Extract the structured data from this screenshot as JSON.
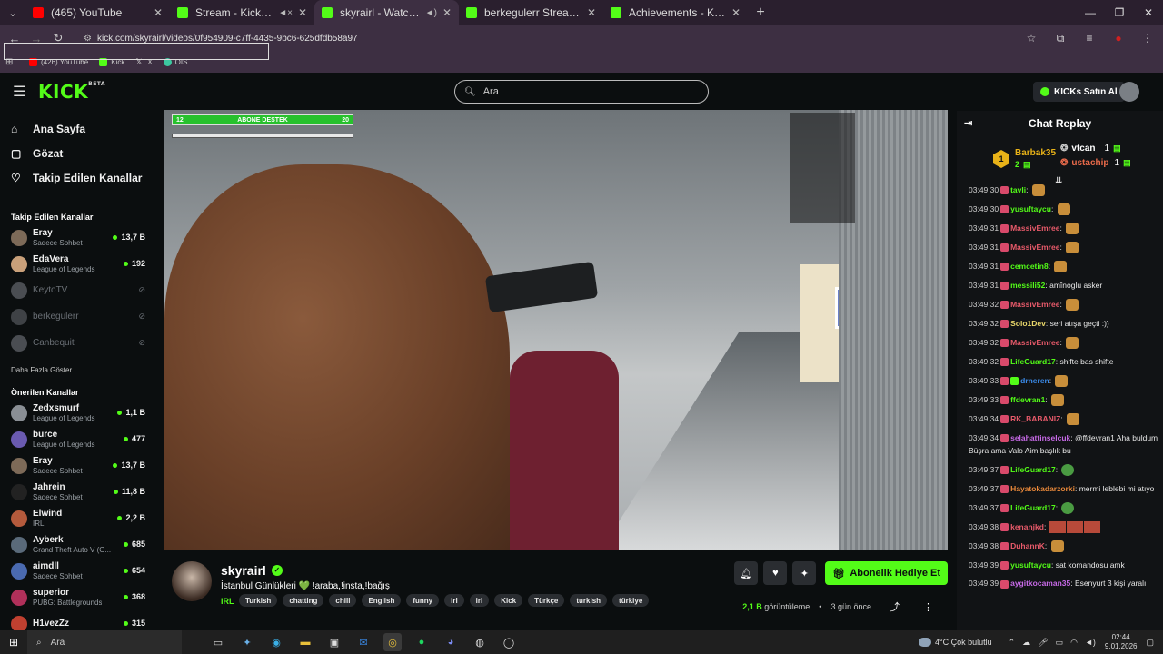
{
  "browser": {
    "tabs": [
      {
        "title": "(465) YouTube",
        "favicon": "youtube-icon",
        "audio": false,
        "active": false
      },
      {
        "title": "Stream - Kick Dashboard",
        "favicon": "kick-icon",
        "audio": true,
        "active": false
      },
      {
        "title": "skyrairl - Watch the VOD on Kick",
        "favicon": "kick-icon",
        "audio": true,
        "active": true
      },
      {
        "title": "berkegulerr Stream - Watch Live",
        "favicon": "kick-icon",
        "audio": false,
        "active": false
      },
      {
        "title": "Achievements - Kick Dashboard",
        "favicon": "kick-icon",
        "audio": false,
        "active": false
      }
    ],
    "url": "kick.com/skyrairl/videos/0f954909-c7ff-4435-9bc6-625dfdb58a97",
    "bookmarks": [
      {
        "label": "(426) YouTube",
        "color": "#ff0000"
      },
      {
        "label": "Kick",
        "color": "#53fc18"
      },
      {
        "label": "X",
        "color": "#cccccc"
      },
      {
        "label": "OIS",
        "color": "#3cc8a0"
      }
    ]
  },
  "kick": {
    "logo": "KICK",
    "logo_sup": "BETA",
    "search_placeholder": "Ara",
    "buy_kicks": "KICKs Satın Al",
    "accent": "#53fc18"
  },
  "sidebar": {
    "nav": [
      {
        "label": "Ana Sayfa",
        "icon": "home-icon",
        "glyph": "⌂"
      },
      {
        "label": "Gözat",
        "icon": "browse-icon",
        "glyph": "▢"
      },
      {
        "label": "Takip Edilen Kanallar",
        "icon": "heart-icon",
        "glyph": "♡"
      }
    ],
    "followed_title": "Takip Edilen Kanallar",
    "followed": [
      {
        "name": "Eray",
        "category": "Sadece Sohbet",
        "viewers": "13,7 B",
        "live": true,
        "color": "#7d6a58"
      },
      {
        "name": "EdaVera",
        "category": "League of Legends",
        "viewers": "192",
        "live": true,
        "color": "#c9a07a"
      },
      {
        "name": "KeytoTV",
        "category": "",
        "viewers": "⊘",
        "live": false,
        "color": "#4a4d52"
      },
      {
        "name": "berkegulerr",
        "category": "",
        "viewers": "⊘",
        "live": false,
        "color": "#3f4246"
      },
      {
        "name": "Canbequit",
        "category": "",
        "viewers": "⊘",
        "live": false,
        "color": "#4a4d52"
      }
    ],
    "show_more": "Daha Fazla Göster",
    "recommended_title": "Önerilen Kanallar",
    "recommended": [
      {
        "name": "Zedxsmurf",
        "category": "League of Legends",
        "viewers": "1,1 B",
        "color": "#8a8f95"
      },
      {
        "name": "burce",
        "category": "League of Legends",
        "viewers": "477",
        "color": "#6a5ab0"
      },
      {
        "name": "Eray",
        "category": "Sadece Sohbet",
        "viewers": "13,7 B",
        "color": "#7d6a58"
      },
      {
        "name": "Jahrein",
        "category": "Sadece Sohbet",
        "viewers": "11,8 B",
        "color": "#222222"
      },
      {
        "name": "Elwind",
        "category": "IRL",
        "viewers": "2,2 B",
        "color": "#b45a3c"
      },
      {
        "name": "Ayberk",
        "category": "Grand Theft Auto V (G...",
        "viewers": "685",
        "color": "#5a6a7a"
      },
      {
        "name": "aimdll",
        "category": "Sadece Sohbet",
        "viewers": "654",
        "color": "#4a6ab0"
      },
      {
        "name": "superior",
        "category": "PUBG: Battlegrounds",
        "viewers": "368",
        "color": "#b0305a"
      },
      {
        "name": "H1vezZz",
        "category": "",
        "viewers": "315",
        "color": "#c04030"
      }
    ]
  },
  "video_overlay": {
    "bar_left": "12",
    "bar_label": "ABONE DESTEK",
    "bar_right": "20"
  },
  "stream": {
    "channel": "skyrairl",
    "title": "İstanbul Günlükleri 💚 !araba,!insta,!bağış",
    "category": "IRL",
    "tags": [
      "Turkish",
      "chatting",
      "chill",
      "English",
      "funny",
      "irl",
      "irl",
      "Kick",
      "Türkçe",
      "turkish",
      "türkiye"
    ],
    "gift_button": "Abonelik Hediye Et",
    "views_count": "2,1 B",
    "views_label": "görüntüleme",
    "age": "3 gün önce"
  },
  "chat": {
    "title": "Chat Replay",
    "gifters": [
      {
        "name": "Barbak35",
        "count": "2",
        "color": "#e8b218"
      },
      {
        "name": "vtcan",
        "count": "1",
        "color": "#ffffff"
      },
      {
        "name": "ustachip",
        "count": "1",
        "color": "#e86a4a"
      }
    ],
    "messages": [
      {
        "time": "03:49:30",
        "user": "tavli",
        "color": "#53fc18",
        "badge": "",
        "text": "",
        "emote": "emote"
      },
      {
        "time": "03:49:30",
        "user": "yusuftaycu",
        "color": "#53fc18",
        "badge": "",
        "text": "",
        "emote": "emote"
      },
      {
        "time": "03:49:31",
        "user": "MassivEmree",
        "color": "#e85a6a",
        "badge": "",
        "text": "",
        "emote": "emote"
      },
      {
        "time": "03:49:31",
        "user": "MassivEmree",
        "color": "#e85a6a",
        "badge": "",
        "text": "",
        "emote": "emote"
      },
      {
        "time": "03:49:31",
        "user": "cemcetin8",
        "color": "#53fc18",
        "badge": "",
        "text": "",
        "emote": "emote"
      },
      {
        "time": "03:49:31",
        "user": "messili52",
        "color": "#53fc18",
        "badge": "",
        "text": "amînoglu asker",
        "emote": ""
      },
      {
        "time": "03:49:32",
        "user": "MassivEmree",
        "color": "#e85a6a",
        "badge": "",
        "text": "",
        "emote": "emote"
      },
      {
        "time": "03:49:32",
        "user": "Solo1Dev",
        "color": "#e8d66a",
        "badge": "",
        "text": "seri atışa geçti :))",
        "emote": ""
      },
      {
        "time": "03:49:32",
        "user": "MassivEmree",
        "color": "#e85a6a",
        "badge": "",
        "text": "",
        "emote": "emote"
      },
      {
        "time": "03:49:32",
        "user": "LifeGuard17",
        "color": "#53fc18",
        "badge": "",
        "text": "shifte bas shifte",
        "emote": ""
      },
      {
        "time": "03:49:33",
        "user": "drneren",
        "color": "#3a8ae8",
        "badge": "g",
        "text": "",
        "emote": "emote"
      },
      {
        "time": "03:49:33",
        "user": "ffdevran1",
        "color": "#53fc18",
        "badge": "",
        "text": "",
        "emote": "emote"
      },
      {
        "time": "03:49:34",
        "user": "RK_BABANIZ",
        "color": "#e85a6a",
        "badge": "",
        "text": "",
        "emote": "emote"
      },
      {
        "time": "03:49:34",
        "user": "selahattinselcuk",
        "color": "#c86ae8",
        "badge": "",
        "text": "@ffdevran1 Aha buldum Büşra ama Valo Aim başlık bu",
        "emote": ""
      },
      {
        "time": "03:49:37",
        "user": "LifeGuard17",
        "color": "#53fc18",
        "badge": "",
        "text": "",
        "emote": "pepe"
      },
      {
        "time": "03:49:37",
        "user": "Hayatokadarzorki",
        "color": "#e8883a",
        "badge": "",
        "text": "mermi leblebi mi atıyo",
        "emote": ""
      },
      {
        "time": "03:49:37",
        "user": "LifeGuard17",
        "color": "#53fc18",
        "badge": "",
        "text": "",
        "emote": "pepe"
      },
      {
        "time": "03:49:38",
        "user": "kenanjkd",
        "color": "#e85a6a",
        "badge": "",
        "text": "",
        "emote": "strip"
      },
      {
        "time": "03:49:38",
        "user": "DuhannK",
        "color": "#e85a6a",
        "badge": "",
        "text": "",
        "emote": "emote"
      },
      {
        "time": "03:49:39",
        "user": "yusuftaycu",
        "color": "#53fc18",
        "badge": "",
        "text": "sat komandosu amk",
        "emote": ""
      },
      {
        "time": "03:49:39",
        "user": "aygitkocaman35",
        "color": "#c86ae8",
        "badge": "",
        "text": "Esenyurt 3 kişi yaralı",
        "emote": ""
      }
    ]
  },
  "taskbar": {
    "search": "Ara",
    "weather_temp": "4°C",
    "weather_text": "Çok bulutlu",
    "time": "02:44",
    "date": "9.01.2026"
  }
}
